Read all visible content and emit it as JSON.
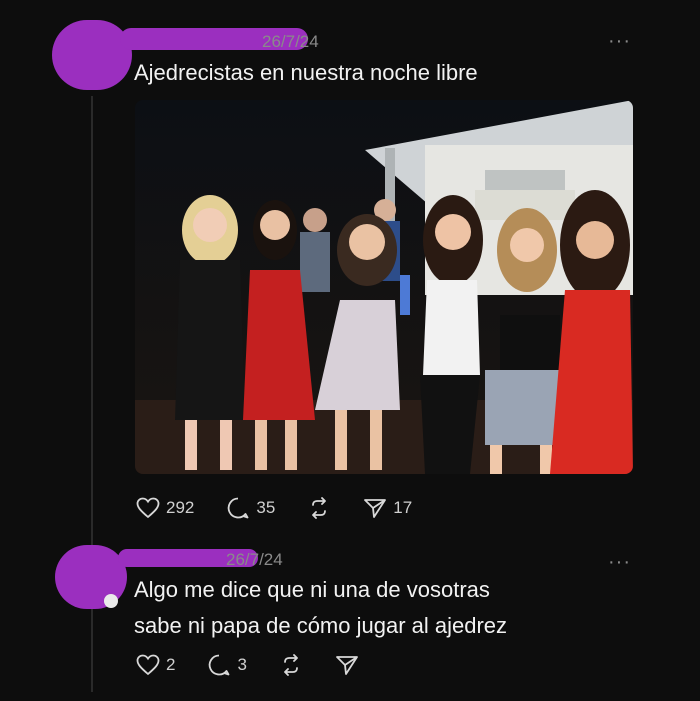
{
  "post1": {
    "date": "26/7/24",
    "text": "Ajedrecistas en nuestra noche libre",
    "more": "···",
    "likes": "292",
    "replies": "35",
    "shares": "17"
  },
  "post2": {
    "date": "26/7/24",
    "text_line1": "Algo me dice que ni una de vosotras",
    "text_line2": "sabe ni papa de cómo jugar al ajedrez",
    "more": "···",
    "likes": "2",
    "replies": "3"
  },
  "colors": {
    "background": "#0d0d0d",
    "redaction": "#9b2fbf",
    "muted": "#8a8a8a"
  },
  "icons": [
    "heart-icon",
    "comment-icon",
    "repost-icon",
    "send-icon",
    "more-icon"
  ]
}
